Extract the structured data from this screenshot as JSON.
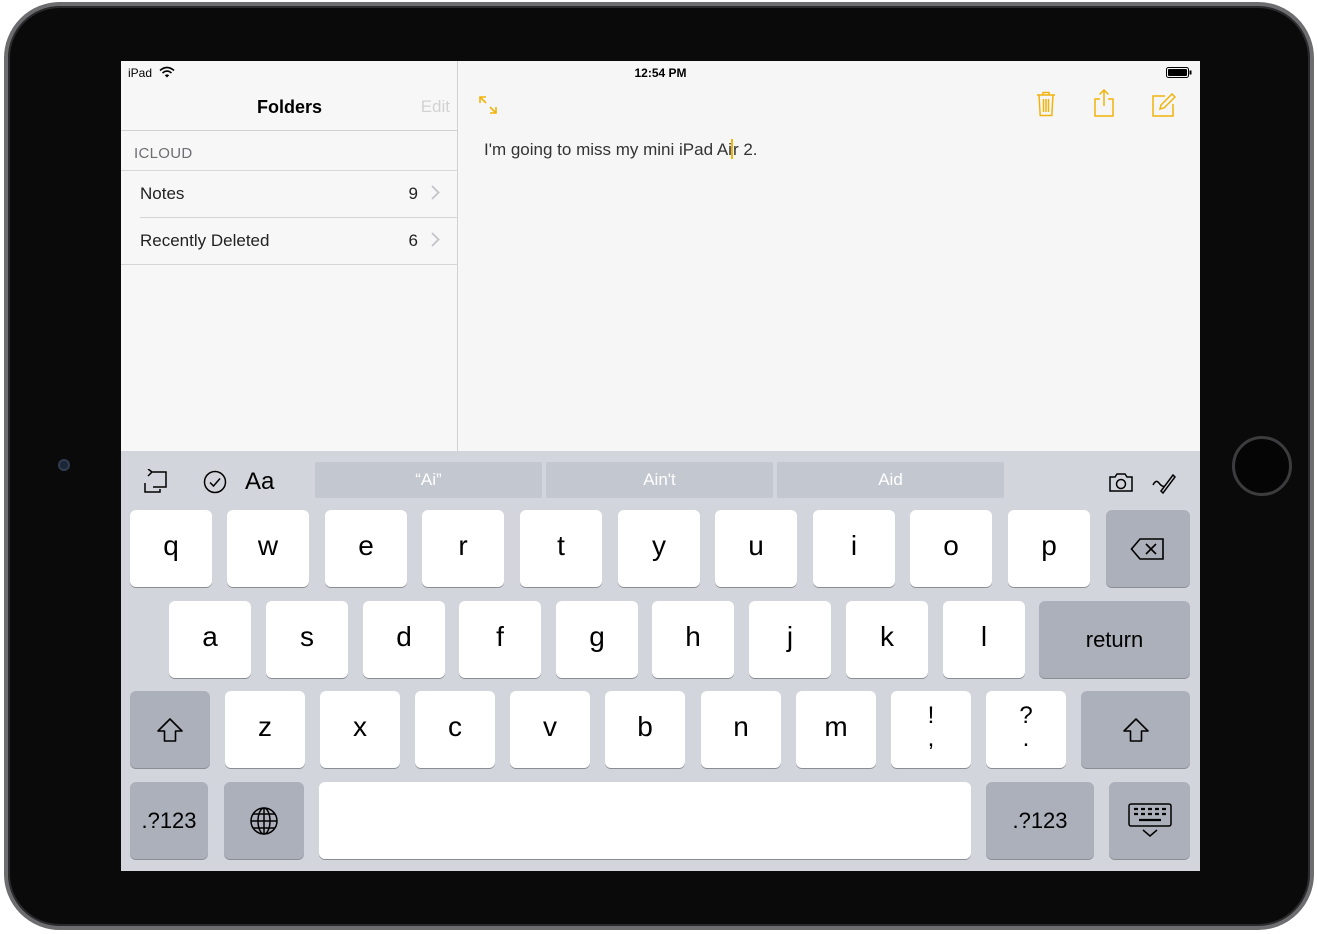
{
  "status_bar": {
    "device": "iPad",
    "time": "12:54 PM"
  },
  "sidebar": {
    "title": "Folders",
    "edit_label": "Edit",
    "section_label": "ICLOUD",
    "folders": [
      {
        "name": "Notes",
        "count": "9"
      },
      {
        "name": "Recently Deleted",
        "count": "6"
      }
    ]
  },
  "note": {
    "text_before_cursor": "I'm going to miss my mini iPad Ai",
    "text_after_cursor": "r 2."
  },
  "toolbar_icons": [
    "expand-icon",
    "trash-icon",
    "share-icon",
    "compose-icon"
  ],
  "accent_color": "#f0b40c",
  "keyboard": {
    "shortcut_icons": [
      "undo-icon",
      "checklist-icon",
      "format-icon",
      "camera-icon",
      "sketch-icon"
    ],
    "format_label": "Aa",
    "suggestions": [
      "“Ai”",
      "Ain't",
      "Aid"
    ],
    "row1": [
      "q",
      "w",
      "e",
      "r",
      "t",
      "y",
      "u",
      "i",
      "o",
      "p"
    ],
    "row2": [
      "a",
      "s",
      "d",
      "f",
      "g",
      "h",
      "j",
      "k",
      "l"
    ],
    "row3": [
      "z",
      "x",
      "c",
      "v",
      "b",
      "n",
      "m"
    ],
    "punct1": {
      "top": "!",
      "bottom": ","
    },
    "punct2": {
      "top": "?",
      "bottom": "."
    },
    "return_label": "return",
    "numbers_label": ".?123"
  }
}
